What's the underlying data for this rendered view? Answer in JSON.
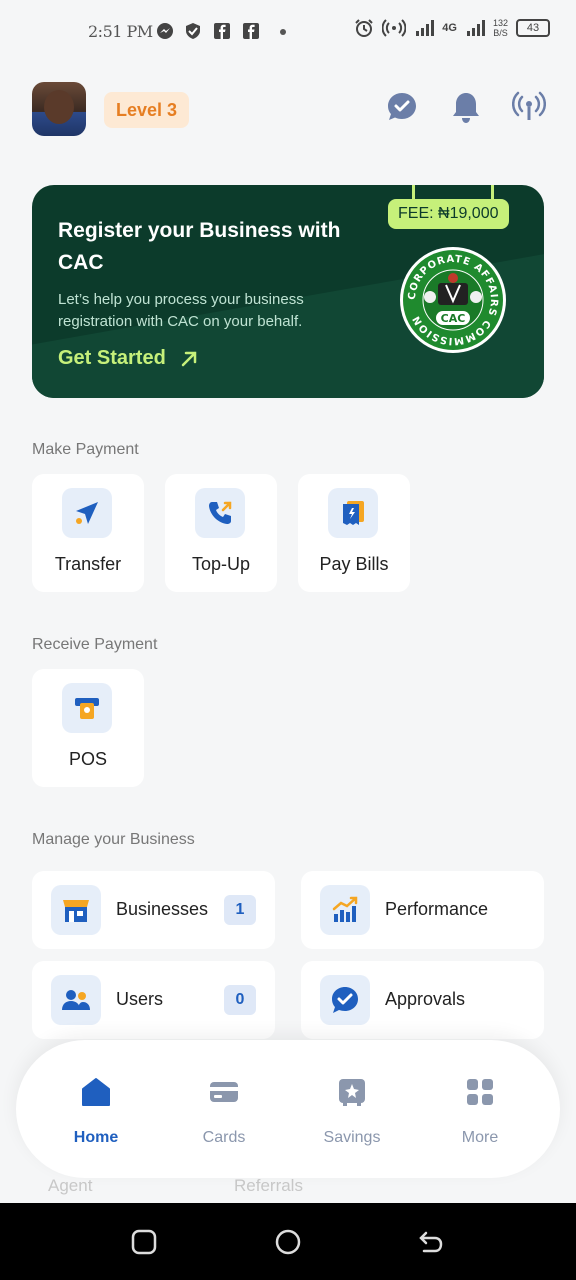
{
  "status_bar": {
    "time": "2:51 PM",
    "network": "4G",
    "speed_value": "132",
    "speed_unit": "B/S",
    "battery": "43"
  },
  "header": {
    "level_label": "Level 3",
    "icons": [
      "check-chat-icon",
      "bell-icon",
      "broadcast-icon"
    ]
  },
  "banner": {
    "title": "Register your Business with CAC",
    "subtitle": "Let’s help you process your business registration with CAC on your behalf.",
    "cta_label": "Get Started",
    "fee_label": "FEE: ₦19,000",
    "seal_top_text": "CORPORATE AFFAIRS COMMISSION",
    "seal_center_text": "CAC"
  },
  "make_payment": {
    "title": "Make Payment",
    "items": [
      {
        "label": "Transfer",
        "icon": "send-icon"
      },
      {
        "label": "Top-Up",
        "icon": "phone-icon"
      },
      {
        "label": "Pay Bills",
        "icon": "bill-icon"
      }
    ]
  },
  "receive_payment": {
    "title": "Receive Payment",
    "items": [
      {
        "label": "POS",
        "icon": "pos-icon"
      }
    ]
  },
  "manage_business": {
    "title": "Manage your Business",
    "items": [
      {
        "label": "Businesses",
        "count": "1",
        "icon": "store-icon"
      },
      {
        "label": "Performance",
        "count": "",
        "icon": "chart-icon"
      },
      {
        "label": "Users",
        "count": "0",
        "icon": "users-icon"
      },
      {
        "label": "Approvals",
        "count": "",
        "icon": "approval-icon"
      }
    ]
  },
  "hidden_row": [
    "Agent",
    "Referrals"
  ],
  "bottom_nav": [
    {
      "label": "Home",
      "icon": "home-icon",
      "active": true
    },
    {
      "label": "Cards",
      "icon": "card-icon",
      "active": false
    },
    {
      "label": "Savings",
      "icon": "savings-icon",
      "active": false
    },
    {
      "label": "More",
      "icon": "grid-icon",
      "active": false
    }
  ],
  "colors": {
    "accent": "#1f5fbf",
    "banner_bg": "#0c3b2b",
    "banner_cta": "#c6f07a",
    "level_text": "#e67e22",
    "level_bg": "#fde9d4"
  }
}
